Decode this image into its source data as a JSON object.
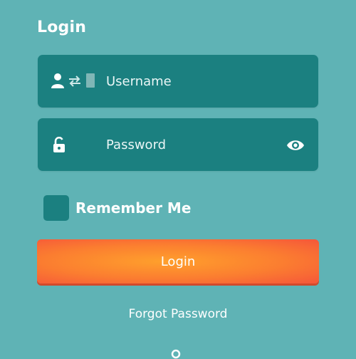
{
  "header": {
    "title": "Login"
  },
  "form": {
    "username": {
      "placeholder": "Username",
      "value": ""
    },
    "password": {
      "placeholder": "Password",
      "value": ""
    },
    "remember_label": "Remember Me",
    "remember_checked": false,
    "login_label": "Login",
    "forgot_label": "Forgot Password"
  },
  "icons": {
    "username": [
      "person-icon",
      "swap-arrows-icon",
      "bar-icon"
    ],
    "password": [
      "unlock-icon"
    ],
    "password_toggle": "eye-icon",
    "bottom": "circle-icon"
  },
  "colors": {
    "background": "#5fb3b5",
    "field": "#1b8080",
    "button_start": "#ffa02c",
    "button_end": "#f5563a",
    "text": "#ffffff"
  }
}
